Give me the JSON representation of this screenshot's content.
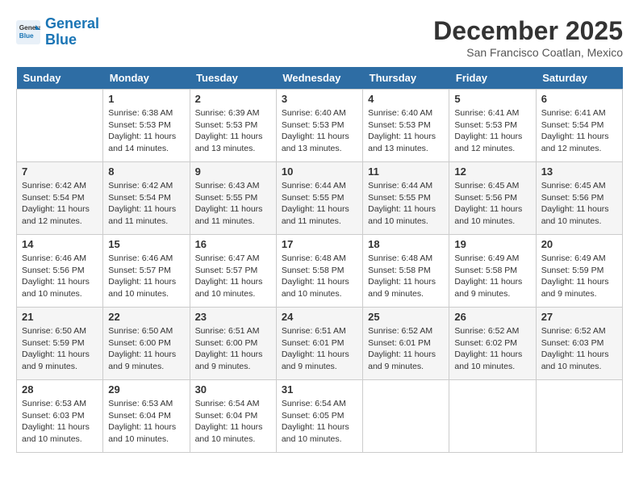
{
  "logo": {
    "text_general": "General",
    "text_blue": "Blue"
  },
  "title": "December 2025",
  "location": "San Francisco Coatlan, Mexico",
  "days": [
    "Sunday",
    "Monday",
    "Tuesday",
    "Wednesday",
    "Thursday",
    "Friday",
    "Saturday"
  ],
  "weeks": [
    [
      {
        "date": "",
        "sunrise": "",
        "sunset": "",
        "daylight": ""
      },
      {
        "date": "1",
        "sunrise": "Sunrise: 6:38 AM",
        "sunset": "Sunset: 5:53 PM",
        "daylight": "Daylight: 11 hours and 14 minutes."
      },
      {
        "date": "2",
        "sunrise": "Sunrise: 6:39 AM",
        "sunset": "Sunset: 5:53 PM",
        "daylight": "Daylight: 11 hours and 13 minutes."
      },
      {
        "date": "3",
        "sunrise": "Sunrise: 6:40 AM",
        "sunset": "Sunset: 5:53 PM",
        "daylight": "Daylight: 11 hours and 13 minutes."
      },
      {
        "date": "4",
        "sunrise": "Sunrise: 6:40 AM",
        "sunset": "Sunset: 5:53 PM",
        "daylight": "Daylight: 11 hours and 13 minutes."
      },
      {
        "date": "5",
        "sunrise": "Sunrise: 6:41 AM",
        "sunset": "Sunset: 5:53 PM",
        "daylight": "Daylight: 11 hours and 12 minutes."
      },
      {
        "date": "6",
        "sunrise": "Sunrise: 6:41 AM",
        "sunset": "Sunset: 5:54 PM",
        "daylight": "Daylight: 11 hours and 12 minutes."
      }
    ],
    [
      {
        "date": "7",
        "sunrise": "Sunrise: 6:42 AM",
        "sunset": "Sunset: 5:54 PM",
        "daylight": "Daylight: 11 hours and 12 minutes."
      },
      {
        "date": "8",
        "sunrise": "Sunrise: 6:42 AM",
        "sunset": "Sunset: 5:54 PM",
        "daylight": "Daylight: 11 hours and 11 minutes."
      },
      {
        "date": "9",
        "sunrise": "Sunrise: 6:43 AM",
        "sunset": "Sunset: 5:55 PM",
        "daylight": "Daylight: 11 hours and 11 minutes."
      },
      {
        "date": "10",
        "sunrise": "Sunrise: 6:44 AM",
        "sunset": "Sunset: 5:55 PM",
        "daylight": "Daylight: 11 hours and 11 minutes."
      },
      {
        "date": "11",
        "sunrise": "Sunrise: 6:44 AM",
        "sunset": "Sunset: 5:55 PM",
        "daylight": "Daylight: 11 hours and 10 minutes."
      },
      {
        "date": "12",
        "sunrise": "Sunrise: 6:45 AM",
        "sunset": "Sunset: 5:56 PM",
        "daylight": "Daylight: 11 hours and 10 minutes."
      },
      {
        "date": "13",
        "sunrise": "Sunrise: 6:45 AM",
        "sunset": "Sunset: 5:56 PM",
        "daylight": "Daylight: 11 hours and 10 minutes."
      }
    ],
    [
      {
        "date": "14",
        "sunrise": "Sunrise: 6:46 AM",
        "sunset": "Sunset: 5:56 PM",
        "daylight": "Daylight: 11 hours and 10 minutes."
      },
      {
        "date": "15",
        "sunrise": "Sunrise: 6:46 AM",
        "sunset": "Sunset: 5:57 PM",
        "daylight": "Daylight: 11 hours and 10 minutes."
      },
      {
        "date": "16",
        "sunrise": "Sunrise: 6:47 AM",
        "sunset": "Sunset: 5:57 PM",
        "daylight": "Daylight: 11 hours and 10 minutes."
      },
      {
        "date": "17",
        "sunrise": "Sunrise: 6:48 AM",
        "sunset": "Sunset: 5:58 PM",
        "daylight": "Daylight: 11 hours and 10 minutes."
      },
      {
        "date": "18",
        "sunrise": "Sunrise: 6:48 AM",
        "sunset": "Sunset: 5:58 PM",
        "daylight": "Daylight: 11 hours and 9 minutes."
      },
      {
        "date": "19",
        "sunrise": "Sunrise: 6:49 AM",
        "sunset": "Sunset: 5:58 PM",
        "daylight": "Daylight: 11 hours and 9 minutes."
      },
      {
        "date": "20",
        "sunrise": "Sunrise: 6:49 AM",
        "sunset": "Sunset: 5:59 PM",
        "daylight": "Daylight: 11 hours and 9 minutes."
      }
    ],
    [
      {
        "date": "21",
        "sunrise": "Sunrise: 6:50 AM",
        "sunset": "Sunset: 5:59 PM",
        "daylight": "Daylight: 11 hours and 9 minutes."
      },
      {
        "date": "22",
        "sunrise": "Sunrise: 6:50 AM",
        "sunset": "Sunset: 6:00 PM",
        "daylight": "Daylight: 11 hours and 9 minutes."
      },
      {
        "date": "23",
        "sunrise": "Sunrise: 6:51 AM",
        "sunset": "Sunset: 6:00 PM",
        "daylight": "Daylight: 11 hours and 9 minutes."
      },
      {
        "date": "24",
        "sunrise": "Sunrise: 6:51 AM",
        "sunset": "Sunset: 6:01 PM",
        "daylight": "Daylight: 11 hours and 9 minutes."
      },
      {
        "date": "25",
        "sunrise": "Sunrise: 6:52 AM",
        "sunset": "Sunset: 6:01 PM",
        "daylight": "Daylight: 11 hours and 9 minutes."
      },
      {
        "date": "26",
        "sunrise": "Sunrise: 6:52 AM",
        "sunset": "Sunset: 6:02 PM",
        "daylight": "Daylight: 11 hours and 10 minutes."
      },
      {
        "date": "27",
        "sunrise": "Sunrise: 6:52 AM",
        "sunset": "Sunset: 6:03 PM",
        "daylight": "Daylight: 11 hours and 10 minutes."
      }
    ],
    [
      {
        "date": "28",
        "sunrise": "Sunrise: 6:53 AM",
        "sunset": "Sunset: 6:03 PM",
        "daylight": "Daylight: 11 hours and 10 minutes."
      },
      {
        "date": "29",
        "sunrise": "Sunrise: 6:53 AM",
        "sunset": "Sunset: 6:04 PM",
        "daylight": "Daylight: 11 hours and 10 minutes."
      },
      {
        "date": "30",
        "sunrise": "Sunrise: 6:54 AM",
        "sunset": "Sunset: 6:04 PM",
        "daylight": "Daylight: 11 hours and 10 minutes."
      },
      {
        "date": "31",
        "sunrise": "Sunrise: 6:54 AM",
        "sunset": "Sunset: 6:05 PM",
        "daylight": "Daylight: 11 hours and 10 minutes."
      },
      {
        "date": "",
        "sunrise": "",
        "sunset": "",
        "daylight": ""
      },
      {
        "date": "",
        "sunrise": "",
        "sunset": "",
        "daylight": ""
      },
      {
        "date": "",
        "sunrise": "",
        "sunset": "",
        "daylight": ""
      }
    ]
  ]
}
